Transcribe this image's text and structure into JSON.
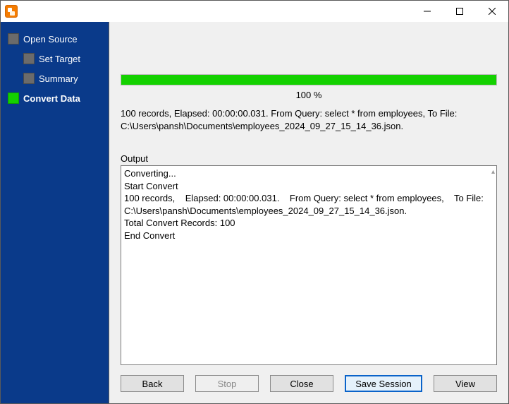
{
  "window": {
    "title": ""
  },
  "sidebar": {
    "items": [
      {
        "label": "Open Source",
        "active": false,
        "child": false
      },
      {
        "label": "Set Target",
        "active": false,
        "child": true
      },
      {
        "label": "Summary",
        "active": false,
        "child": true
      },
      {
        "label": "Convert Data",
        "active": true,
        "child": false
      }
    ]
  },
  "progress": {
    "percent": 100,
    "label": "100 %"
  },
  "summary": "100 records,    Elapsed: 00:00:00.031.    From Query: select * from employees,    To File: C:\\Users\\pansh\\Documents\\employees_2024_09_27_15_14_36.json.",
  "output": {
    "label": "Output",
    "text": "Converting...\nStart Convert\n100 records,    Elapsed: 00:00:00.031.    From Query: select * from employees,    To File: C:\\Users\\pansh\\Documents\\employees_2024_09_27_15_14_36.json.\nTotal Convert Records: 100\nEnd Convert"
  },
  "buttons": {
    "back": "Back",
    "stop": "Stop",
    "close": "Close",
    "save_session": "Save Session",
    "view": "View"
  }
}
